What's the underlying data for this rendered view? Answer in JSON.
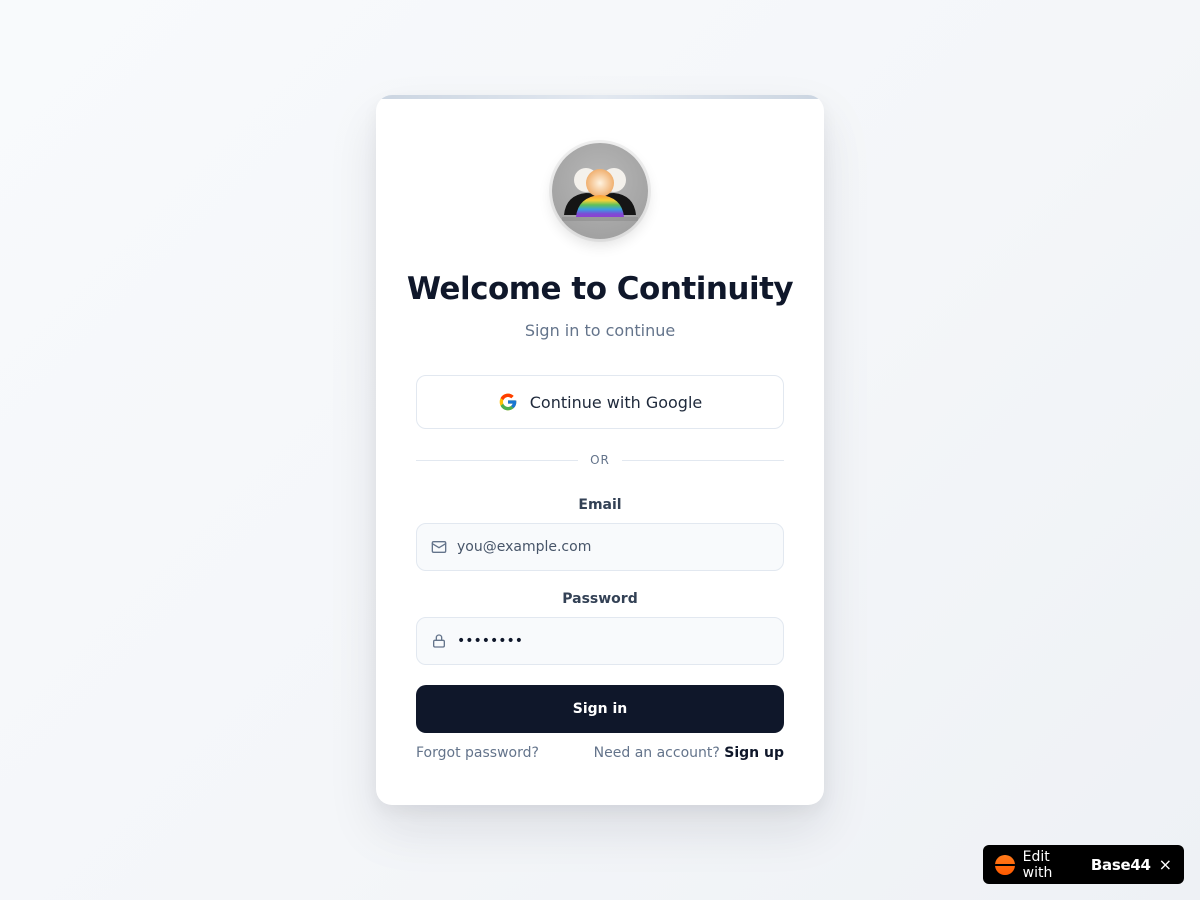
{
  "app": {
    "title": "Welcome to Continuity",
    "subtitle": "Sign in to continue"
  },
  "auth": {
    "google_label": "Continue with Google",
    "divider_text": "OR",
    "email_label": "Email",
    "email_placeholder": "you@example.com",
    "password_label": "Password",
    "password_value": "••••••••",
    "signin_label": "Sign in",
    "forgot_label": "Forgot password?",
    "need_account_label": "Need an account?",
    "signup_label": "Sign up"
  },
  "badge": {
    "edit_label": "Edit with",
    "brand_label": "Base44",
    "close_label": "×"
  },
  "icons": {
    "logo": "people-group-logo",
    "google": "google-icon",
    "email": "mail-icon",
    "password": "lock-icon",
    "badge": "base44-dot-icon",
    "close": "close-icon"
  },
  "colors": {
    "primary": "#0f172a",
    "muted": "#64748b",
    "border": "#e2e8f0",
    "badge_accent": "#ff6a00"
  }
}
